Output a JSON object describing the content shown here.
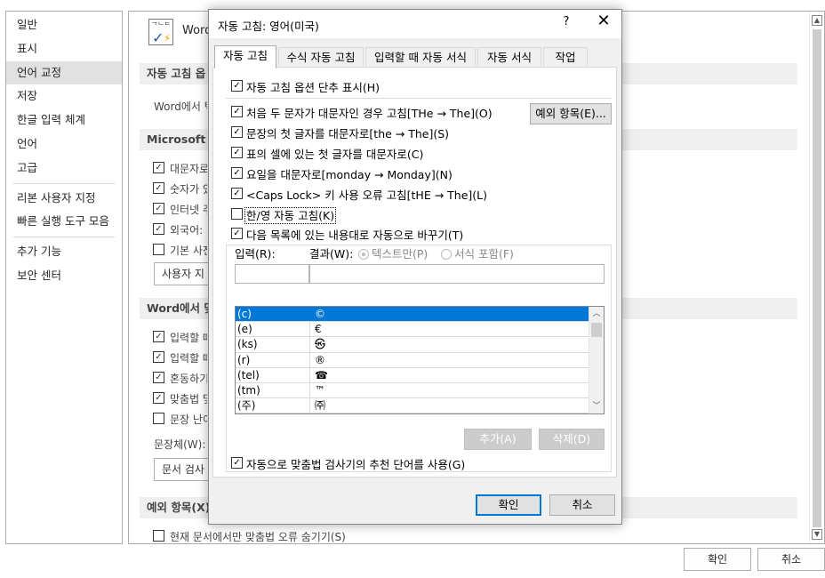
{
  "options_window": {
    "nav_items": [
      {
        "label": "일반"
      },
      {
        "label": "표시"
      },
      {
        "label": "언어 교정"
      },
      {
        "label": "저장"
      },
      {
        "label": "한글 입력 체계"
      },
      {
        "label": "언어"
      },
      {
        "label": "고급"
      },
      {
        "label": "리본 사용자 지정"
      },
      {
        "label": "빠른 실행 도구 모음"
      },
      {
        "label": "추가 기능"
      },
      {
        "label": "보안 센터"
      }
    ],
    "selected_nav": "언어 교정",
    "header_word": "Word",
    "sections": {
      "autocorrect_header": "자동 고침 옵",
      "autocorrect_desc": "Word에서 텍",
      "office_header": "Microsoft Of",
      "word_header": "Word에서 맞",
      "exceptions_header": "예외 항목(X):"
    },
    "office_options": [
      "대문자로",
      "숫자가 있",
      "인터넷 주",
      "외국어:",
      "기본 사전"
    ],
    "office_option_checked": [
      true,
      true,
      true,
      true,
      false
    ],
    "custom_dict_button": "사용자 지",
    "word_options": [
      "입력할 때",
      "입력할 때",
      "혼동하기",
      "맞춤법 및",
      "문장 난이"
    ],
    "word_option_checked": [
      true,
      true,
      true,
      true,
      false
    ],
    "writing_style_label": "문장체(W):",
    "writing_style_value": "문서 검사",
    "hide_errors_option": "현재 문서에서만 맞춤법 오류 숨기기(S)",
    "ok_button": "확인",
    "cancel_button": "취소"
  },
  "dialog": {
    "title": "자동 고침: 영어(미국)",
    "help": "?",
    "close": "✕",
    "tabs": [
      {
        "label": "자동 고침",
        "active": true
      },
      {
        "label": "수식 자동 고침",
        "active": false
      },
      {
        "label": "입력할 때 자동 서식",
        "active": false
      },
      {
        "label": "자동 서식",
        "active": false
      },
      {
        "label": "작업",
        "active": false
      }
    ],
    "show_buttons": {
      "label": "자동 고침 옵션 단추 표시(H)",
      "checked": true
    },
    "options": [
      {
        "label": "처음 두 문자가 대문자인 경우 고침[THe → The](O)",
        "checked": true
      },
      {
        "label": "문장의 첫 글자를 대문자로[the → The](S)",
        "checked": true
      },
      {
        "label": "표의 셀에 있는 첫 글자를 대문자로(C)",
        "checked": true
      },
      {
        "label": "요일을 대문자로[monday → Monday](N)",
        "checked": true
      },
      {
        "label": "<Caps Lock> 키 사용 오류 고침[tHE → The](L)",
        "checked": true
      },
      {
        "label": "한/영 자동 고침(K)",
        "checked": false
      }
    ],
    "exceptions_button": "예외 항목(E)...",
    "replace_as_type": {
      "label": "다음 목록에 있는 내용대로 자동으로 바꾸기(T)",
      "checked": true
    },
    "input_label": "입력(R):",
    "result_label": "결과(W):",
    "radio_plain": "텍스트만(P)",
    "radio_formatted": "서식 포함(F)",
    "input_value": "",
    "result_value": "",
    "list": [
      {
        "input": "(c)",
        "result": "©"
      },
      {
        "input": "(e)",
        "result": "€"
      },
      {
        "input": "(ks)",
        "result": "㉿"
      },
      {
        "input": "(r)",
        "result": "®"
      },
      {
        "input": "(tel)",
        "result": "☎"
      },
      {
        "input": "(tm)",
        "result": "™"
      },
      {
        "input": "(주)",
        "result": "㈜"
      }
    ],
    "add_button": "추가(A)",
    "delete_button": "삭제(D)",
    "spelling_suggestions": {
      "label": "자동으로 맞춤법 검사기의 추천 단어를 사용(G)",
      "checked": true
    },
    "ok_button": "확인",
    "cancel_button": "취소"
  }
}
